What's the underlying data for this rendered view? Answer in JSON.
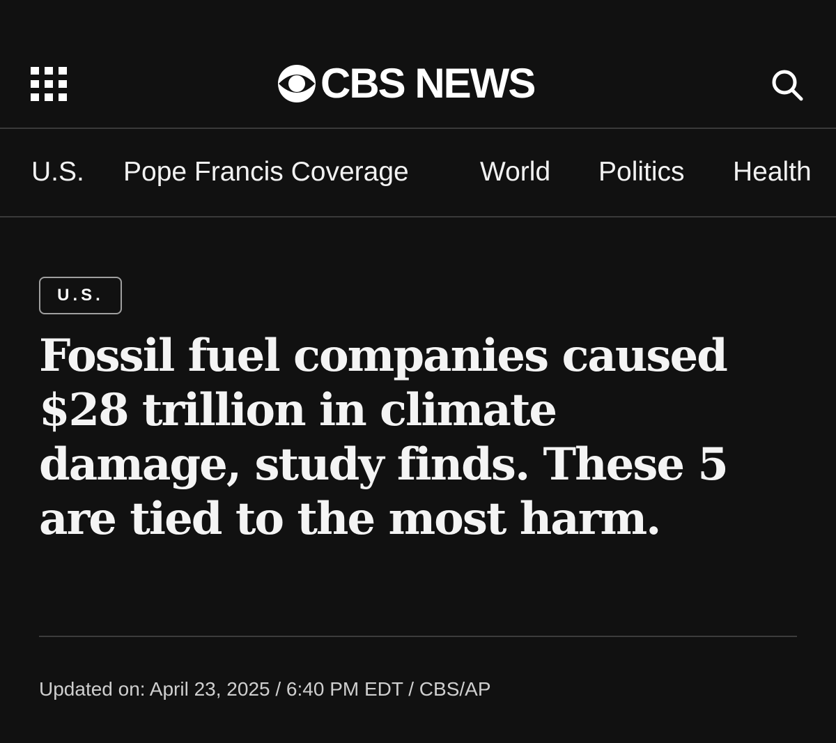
{
  "header": {
    "menu_icon": "grid-menu-icon",
    "logo_icon": "cbs-eye-icon",
    "logo_text": "CBS NEWS",
    "search_icon": "search-icon"
  },
  "nav": {
    "items": [
      {
        "label": "U.S."
      },
      {
        "label": "Pope Francis Coverage"
      },
      {
        "label": "World"
      },
      {
        "label": "Politics"
      },
      {
        "label": "Health"
      }
    ]
  },
  "article": {
    "category_tag": "U.S.",
    "headline": "Fossil fuel companies caused $28 trillion in climate damage, study finds. These 5 are tied to the most harm.",
    "byline": "Updated on: April 23, 2025 / 6:40 PM EDT / CBS/AP"
  },
  "colors": {
    "background": "#111111",
    "text": "#ffffff",
    "divider": "#3a3a3a"
  }
}
